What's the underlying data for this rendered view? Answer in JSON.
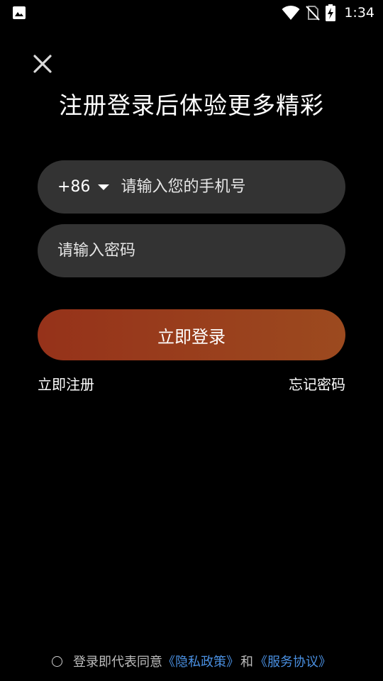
{
  "status_bar": {
    "time": "1:34",
    "icons": [
      "gallery-icon",
      "wifi-icon",
      "no-sim-icon",
      "battery-charging-icon"
    ]
  },
  "headline": "注册登录后体验更多精彩",
  "phone_field": {
    "country_code": "+86",
    "placeholder": "请输入您的手机号"
  },
  "password_field": {
    "placeholder": "请输入密码"
  },
  "login_button": "立即登录",
  "register_link": "立即注册",
  "forgot_link": "忘记密码",
  "agreement": {
    "prefix": "登录即代表同意",
    "privacy": "《隐私政策》",
    "and": "和",
    "service": "《服务协议》"
  },
  "colors": {
    "background": "#000000",
    "field_bg": "#333333",
    "button_gradient_start": "#96321a",
    "button_gradient_end": "#9c4a1f",
    "link": "#4a90e2"
  }
}
